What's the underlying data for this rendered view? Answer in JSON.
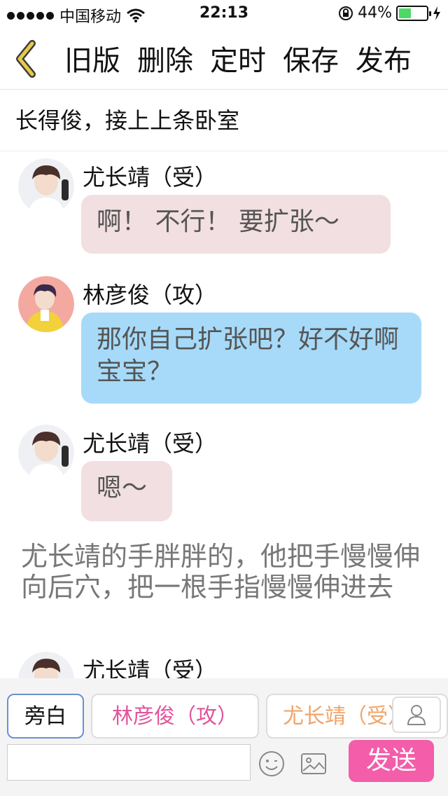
{
  "status_bar": {
    "carrier": "中国移动",
    "time": "22:13",
    "battery_percent": "44%",
    "battery_level": 0.44
  },
  "toolbar": {
    "actions": [
      "旧版",
      "删除",
      "定时",
      "保存",
      "发布"
    ]
  },
  "story_title": "长得俊，接上上条卧室",
  "messages": [
    {
      "type": "dialog",
      "speaker": "尤长靖（受）",
      "text": "啊！ 不行！ 要扩张～"
    },
    {
      "type": "dialog",
      "speaker": "林彦俊（攻）",
      "text": "那你自己扩张吧？好不好啊宝宝？"
    },
    {
      "type": "dialog",
      "speaker": "尤长靖（受）",
      "text": "嗯～"
    },
    {
      "type": "narration",
      "text": "尤长靖的手胖胖的，他把手慢慢伸向后穴，把一根手指慢慢伸进去"
    },
    {
      "type": "dialog",
      "speaker": "尤长靖（受）",
      "text": ""
    }
  ],
  "composer": {
    "roles": [
      "旁白",
      "林彦俊（攻）",
      "尤长靖（受）"
    ],
    "selected_role": "旁白",
    "input_value": "",
    "send_label": "发送"
  },
  "colors": {
    "shou_bubble": "#f2dfe1",
    "gong_bubble": "#a6daf8",
    "send_button": "#f35daa",
    "back_chevron": "#e6c94a"
  }
}
